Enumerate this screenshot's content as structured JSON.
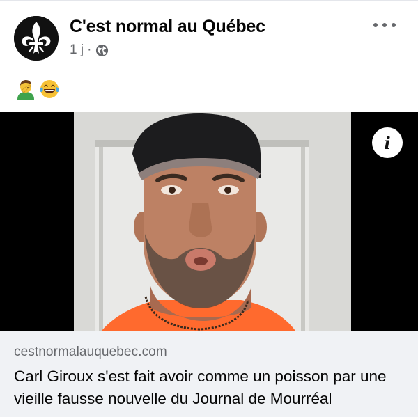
{
  "post": {
    "page_name": "C'est normal au Québec",
    "time": "1 j",
    "separator": "·",
    "privacy_icon": "globe-icon",
    "more_icon": "more-options-icon",
    "emojis": [
      "man-facepalming-emoji",
      "tears-of-joy-emoji"
    ]
  },
  "video": {
    "info_label": "i",
    "info_icon": "info-icon"
  },
  "link": {
    "domain": "cestnormalauquebec.com",
    "title": "Carl Giroux s'est fait avoir comme un poisson par une vieille fausse nouvelle du Journal de Mourréal"
  },
  "colors": {
    "text_primary": "#050505",
    "text_secondary": "#65676b",
    "link_bg": "#f0f2f5"
  }
}
